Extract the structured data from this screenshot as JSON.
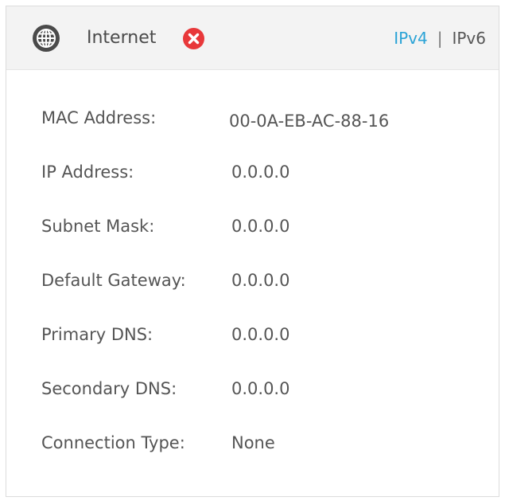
{
  "header": {
    "title": "Internet",
    "status_icon": "error-x-icon",
    "globe_icon": "globe-icon",
    "ipv4_label": "IPv4",
    "separator": "|",
    "ipv6_label": "IPv6",
    "active_tab": "IPv4"
  },
  "colors": {
    "accent": "#2aa3d6",
    "error": "#e8383a",
    "header_bg": "#f3f3f3",
    "text": "#555555"
  },
  "fields": [
    {
      "label": "MAC Address:",
      "value": "00-0A-EB-AC-88-16"
    },
    {
      "label": "IP Address:",
      "value": "0.0.0.0"
    },
    {
      "label": "Subnet Mask:",
      "value": "0.0.0.0"
    },
    {
      "label": "Default Gateway:",
      "value": "0.0.0.0"
    },
    {
      "label": "Primary DNS:",
      "value": "0.0.0.0"
    },
    {
      "label": "Secondary DNS:",
      "value": "0.0.0.0"
    },
    {
      "label": "Connection Type:",
      "value": "None"
    }
  ]
}
